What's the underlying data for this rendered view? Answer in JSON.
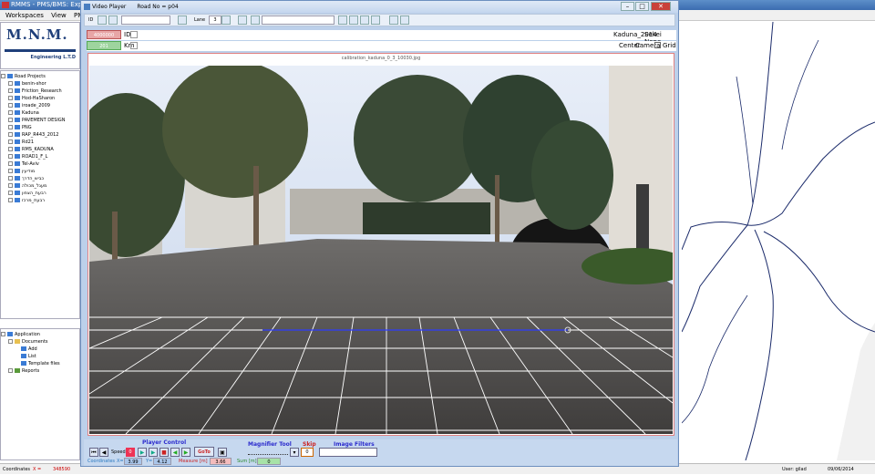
{
  "app": {
    "title": "RMMS - PMS/BMS: Expert S",
    "menu": [
      "Workspaces",
      "View",
      "PMS",
      "B"
    ]
  },
  "logo": {
    "name": "M.N.M.",
    "subtitle": "Engineering L.T.D"
  },
  "tree": {
    "root": "Road Projects",
    "items": [
      "benin-shor",
      "Friction_Research",
      "Hod-HaSharon",
      "iroade_2009",
      "Kaduna",
      "PAVEMENT DESIGN",
      "PNG",
      "RAP_R443_2012",
      "Rd21",
      "RMS_KADUNA",
      "ROAD1_F_L",
      "Tel-Aviv",
      "מודיעין",
      "כביש_הדרך",
      "מעגל_מכולה",
      "רבעת_הצפון",
      "רבעת_מרכז"
    ]
  },
  "docs": {
    "root": "Application",
    "documents": "Documents",
    "add": "Add",
    "list": "List",
    "template": "Template files",
    "reports": "Reports"
  },
  "video_player": {
    "title": "Video Player",
    "road": "Road No = p04",
    "toolbar": {
      "id_label": "ID",
      "lane_label": "Lane",
      "lane_value": "3"
    },
    "row2": {
      "value": "4000000",
      "id_label": "ID",
      "road_name": "Kaduna_2014",
      "sekei": "Sekei None"
    },
    "row3": {
      "value": "201",
      "unit": "Km",
      "center": "Center",
      "camera": "Camera",
      "grid": "Grid"
    },
    "image_title": "calibration_kaduna_0_3_10030.jpg",
    "controls": {
      "player_control": "Player Control",
      "speed": "Speed",
      "speed_value": "0",
      "goto": "GoTo",
      "magnifier": "Magnifier Tool",
      "skip": "Skip",
      "skip_value": "0",
      "image_filters": "Image Filters",
      "coordinates": "Coordinates",
      "x_label": "X=",
      "x_value": "3.99",
      "y_label": "Y=",
      "y_value": "4.12",
      "measure_label": "Measure [m]",
      "measure_value": "3.66",
      "sum_label": "Sum [m]",
      "sum_value": "0"
    }
  },
  "statusbar": {
    "coordinates": "Coordinates",
    "x_label": "X =",
    "x_value": "348590",
    "user": "User: gilad",
    "date": "09/06/2014"
  }
}
